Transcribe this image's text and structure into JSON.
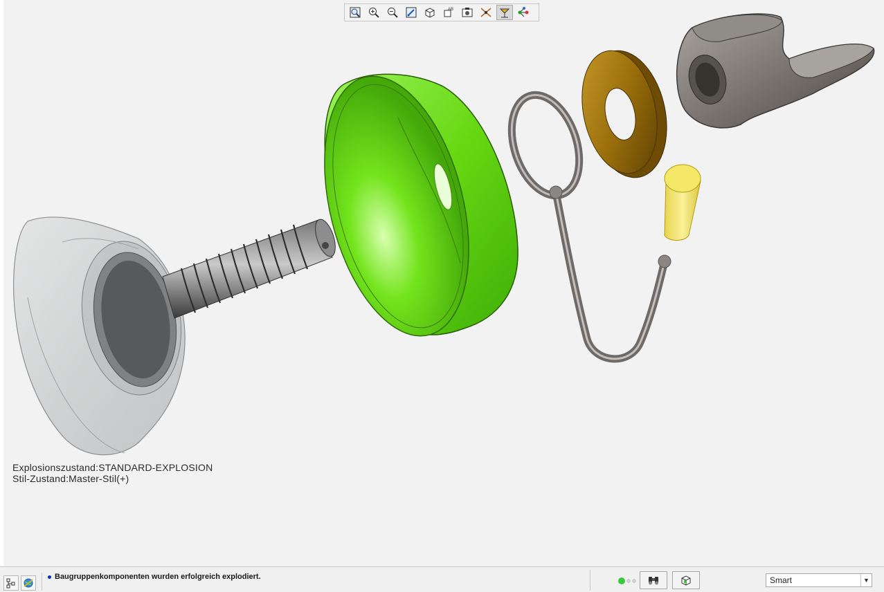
{
  "viewport": {
    "explode_state_label": "Explosionszustand:STANDARD-EXPLOSION",
    "style_state_label": "Stil-Zustand:Master-Stil(+)"
  },
  "toolbar": {
    "buttons": [
      {
        "name": "refit-icon"
      },
      {
        "name": "zoom-in-icon"
      },
      {
        "name": "zoom-out-icon"
      },
      {
        "name": "repaint-icon"
      },
      {
        "name": "display-style-icon"
      },
      {
        "name": "saved-orientations-icon"
      },
      {
        "name": "view-manager-icon"
      },
      {
        "name": "datum-display-icon"
      },
      {
        "name": "annotation-display-icon",
        "active": true
      },
      {
        "name": "spin-center-icon"
      }
    ]
  },
  "statusbar": {
    "message": "Baugruppenkomponenten wurden erfolgreich explodiert.",
    "filter_value": "Smart"
  },
  "colors": {
    "bowl_green": "#6ee317",
    "washer_bronze": "#9a6f0c",
    "wing_nut_gray": "#7b7672",
    "pin_yellow": "#f1e35a",
    "message_dot": "#0a2dc9",
    "progress_green": "#3cc83c"
  }
}
